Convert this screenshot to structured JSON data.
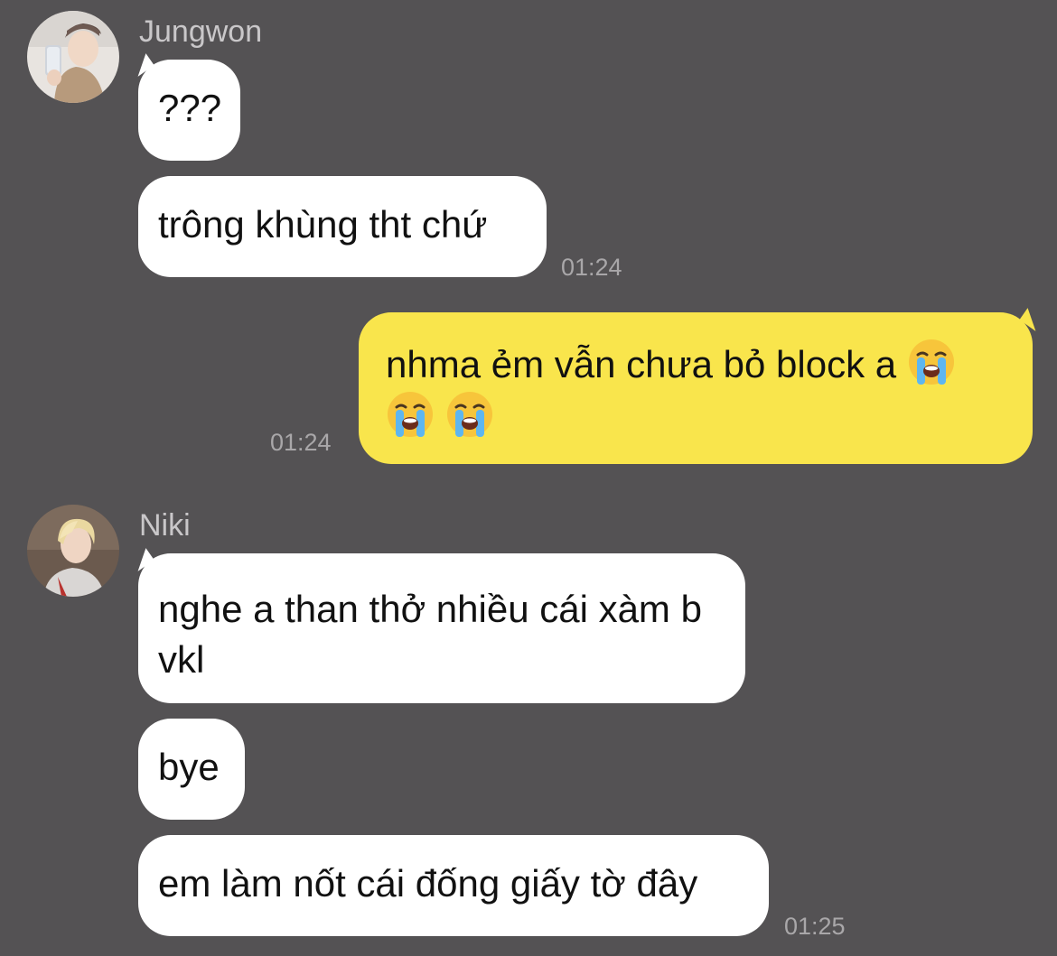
{
  "chat": {
    "groups": [
      {
        "sender": "Jungwon",
        "messages": [
          "???",
          "trông khùng tht chứ"
        ],
        "time": "01:24"
      },
      {
        "sender": "Niki",
        "messages": [
          "nghe a than thở nhiều cái xàm b vkl",
          "bye",
          "em làm nốt cái đống giấy tờ đây"
        ],
        "time": "01:25"
      }
    ],
    "outgoing": {
      "text": "nhma ẻm vẫn chưa bỏ block a",
      "emoji": [
        "loudly-crying-face-icon",
        "loudly-crying-face-icon",
        "loudly-crying-face-icon"
      ],
      "time": "01:24"
    }
  },
  "colors": {
    "background": "#545254",
    "incoming_bubble": "#ffffff",
    "outgoing_bubble": "#f9e54c",
    "name_text": "#c9c7c9",
    "time_text": "#a9a7a9"
  }
}
